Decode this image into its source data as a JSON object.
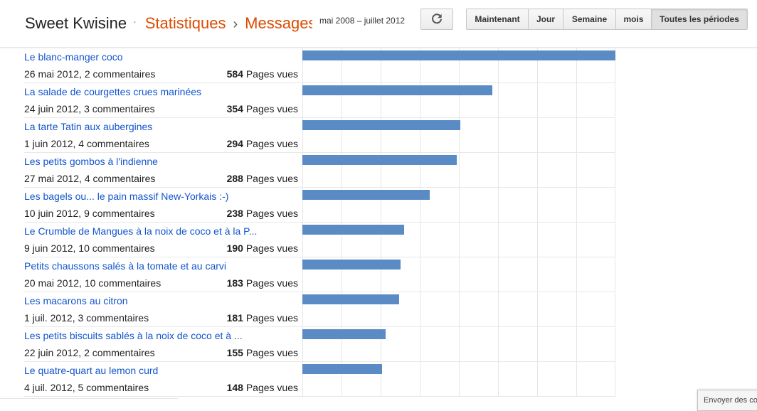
{
  "header": {
    "blog_name": "Sweet Kwisine",
    "separator_dot": "·",
    "section": "Statistiques",
    "breadcrumb_sep": "›",
    "subsection": "Messages",
    "date_range": "mai 2008 – juillet 2012",
    "refresh_icon": "refresh-icon",
    "periods": [
      {
        "label": "Maintenant",
        "active": false
      },
      {
        "label": "Jour",
        "active": false
      },
      {
        "label": "Semaine",
        "active": false
      },
      {
        "label": "mois",
        "active": false
      },
      {
        "label": "Toutes les périodes",
        "active": true
      }
    ]
  },
  "views_suffix": "Pages vues",
  "posts": [
    {
      "title": "Le blanc-manger coco",
      "meta": "26 mai 2012, 2 commentaires",
      "views": 584
    },
    {
      "title": "La salade de courgettes crues marinées",
      "meta": "24 juin 2012, 3 commentaires",
      "views": 354
    },
    {
      "title": "La tarte Tatin aux aubergines",
      "meta": "1 juin 2012, 4 commentaires",
      "views": 294
    },
    {
      "title": "Les petits gombos à l'indienne",
      "meta": "27 mai 2012, 4 commentaires",
      "views": 288
    },
    {
      "title": "Les bagels ou... le pain massif New-Yorkais :-)",
      "meta": "10 juin 2012, 9 commentaires",
      "views": 238
    },
    {
      "title": "Le Crumble de Mangues à la noix de coco et à la P...",
      "meta": "9 juin 2012, 10 commentaires",
      "views": 190
    },
    {
      "title": "Petits chaussons salés à la tomate et au carvi",
      "meta": "20 mai 2012, 10 commentaires",
      "views": 183
    },
    {
      "title": "Les macarons au citron",
      "meta": "1 juil. 2012, 3 commentaires",
      "views": 181
    },
    {
      "title": "Les petits biscuits sablés à la noix de coco et à ...",
      "meta": "22 juin 2012, 2 commentaires",
      "views": 155
    },
    {
      "title": "Le quatre-quart au lemon curd",
      "meta": "4 juil. 2012, 5 commentaires",
      "views": 148
    }
  ],
  "feedback_label": "Envoyer des commentaires",
  "colors": {
    "accent": "#dd4b00",
    "link": "#1155cc",
    "bar": "#5b8bc5"
  }
}
